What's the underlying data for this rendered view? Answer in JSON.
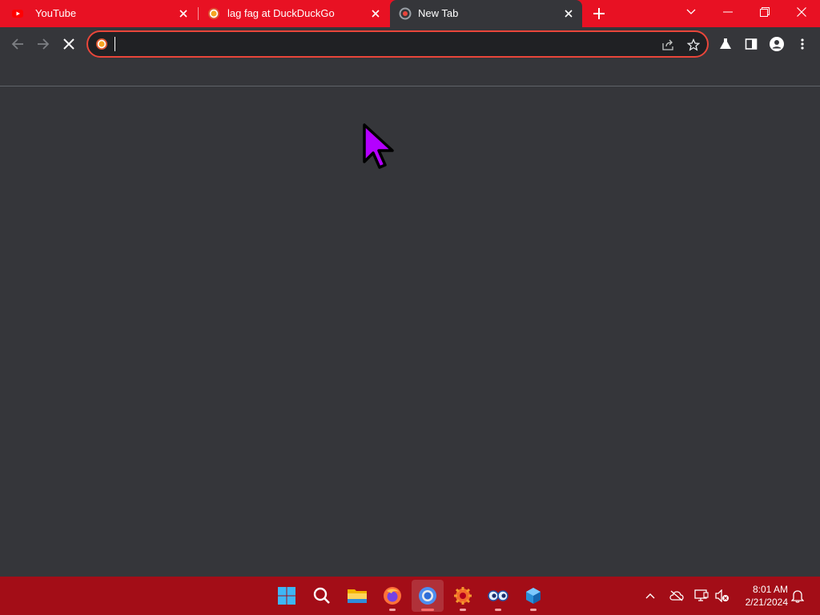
{
  "tabs": [
    {
      "title": "YouTube",
      "favicon": "youtube-icon",
      "active": false
    },
    {
      "title": "lag fag at DuckDuckGo",
      "favicon": "duckduckgo-icon",
      "active": false
    },
    {
      "title": "New Tab",
      "favicon": "chrome-newtab-icon",
      "active": true
    }
  ],
  "omnibox": {
    "value": "",
    "placeholder": ""
  },
  "colors": {
    "tabstrip": "#e81123",
    "toolbar": "#35363a",
    "omnibox_border": "#e9463a",
    "taskbar": "#a30d17",
    "cursor": "#b400ff"
  },
  "taskbar": {
    "apps": [
      "windows-start-icon",
      "search-icon",
      "file-explorer-icon",
      "firefox-icon",
      "chrome-icon",
      "settings-app-icon",
      "eyes-app-icon",
      "cube-app-icon"
    ]
  },
  "clock": {
    "time": "8:01 AM",
    "date": "2/21/2024"
  }
}
